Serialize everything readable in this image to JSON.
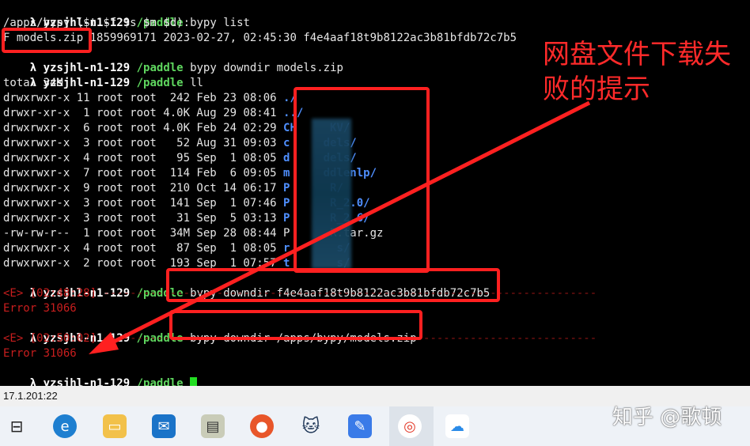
{
  "prompt": {
    "lambda": "λ",
    "host": "yzsjhl-n1-129",
    "path": "/paddle"
  },
  "lines": {
    "l1_cmd": "bypy list",
    "l2": "/apps/bypy ($t $f $s $m $d):",
    "l3_type": "F",
    "l3_name": "models.zip",
    "l3_rest": " 1859969171 2023-02-27, 02:45:30 f4e4aaf18t9b8122ac3b81bfdb72c7b5",
    "l4_cmd": "bypy downdir models.zip",
    "l5_cmd": "ll",
    "l6": "total 34M"
  },
  "listing": [
    {
      "meta": "drwxrwxr-x 11 root root  242 Feb 23 08:06 ",
      "name": "./",
      "kind": "dir"
    },
    {
      "meta": "drwxr-xr-x  1 root root 4.0K Aug 29 08:41 ",
      "name": "../",
      "kind": "dir"
    },
    {
      "meta": "drwxrwxr-x  6 root root 4.0K Feb 24 02:29 ",
      "name": "CH     KV/",
      "kind": "dir"
    },
    {
      "meta": "drwxrwxr-x  3 root root   52 Aug 31 09:03 ",
      "name": "c     dels/",
      "kind": "dir"
    },
    {
      "meta": "drwxrwxr-x  4 root root   95 Sep  1 08:05 ",
      "name": "d     dels/",
      "kind": "dir"
    },
    {
      "meta": "drwxrwxr-x  7 root root  114 Feb  6 09:05 ",
      "name": "m     ddlenlp/",
      "kind": "dir"
    },
    {
      "meta": "drwxrwxr-x  9 root root  210 Oct 14 06:17 ",
      "name": "P      R/",
      "kind": "dir"
    },
    {
      "meta": "drwxrwxr-x  3 root root  141 Sep  1 07:46 ",
      "name": "P      R_2.0/",
      "kind": "dir"
    },
    {
      "meta": "drwxrwxr-x  3 root root   31 Sep  5 03:13 ",
      "name": "P      R_2.6/",
      "kind": "dir"
    },
    {
      "meta": "-rw-rw-r--  1 root root  34M Sep 28 08:44 ",
      "name": "P      R.tar.gz",
      "kind": "file"
    },
    {
      "meta": "drwxrwxr-x  4 root root   87 Sep  1 08:05 ",
      "name": "r       s/",
      "kind": "dir"
    },
    {
      "meta": "drwxrwxr-x  2 root root  193 Sep  1 07:57 ",
      "name": "t       s/",
      "kind": "dir"
    }
  ],
  "cmd2": "bypy downdir f4e4aaf18t9b8122ac3b81bfdb72c7b5",
  "err1_time": "<E> [02:48:28] ",
  "err1_dashes": "--------------------------------------------------------------------------",
  "err1_msg": "Error 31066",
  "cmd3": "bypy downdir /apps/bypy/models.zip",
  "err2_time": "<E> [02:50:02] ",
  "err2_dashes": "--------------------------------------------------------------------------",
  "err2_msg": "Error 31066",
  "annotation": {
    "line1": "网盘文件下载失",
    "line2": "败的提示",
    "color": "#ff2a2a"
  },
  "statusbar": {
    "text": "17.1.201:22"
  },
  "watermark": "知乎 @歌顿",
  "taskbar": {
    "icons": [
      "task-view-icon",
      "edge-icon",
      "file-explorer-icon",
      "mail-icon",
      "certificate-manager-icon",
      "firefox-icon",
      "cat-app-icon",
      "pen-app-icon",
      "snail-app-icon",
      "baidu-netdisk-icon"
    ]
  },
  "colors": {
    "accent_red": "#ff2020",
    "path_green": "#5fd75f",
    "dir_blue": "#4f8fff",
    "error_red": "#c81e1e"
  }
}
